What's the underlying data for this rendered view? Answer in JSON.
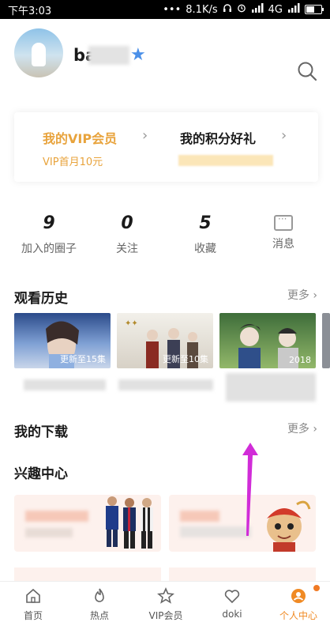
{
  "status_bar": {
    "time": "下午3:03",
    "dots": "•••",
    "network_speed": "8.1K/s",
    "signal_label": "4G"
  },
  "profile": {
    "username_visible": "ba"
  },
  "vip_card": {
    "vip_title": "我的VIP会员",
    "vip_subtitle": "VIP首月10元",
    "points_title": "我的积分好礼"
  },
  "stats": [
    {
      "value": "9",
      "label": "加入的圈子"
    },
    {
      "value": "0",
      "label": "关注"
    },
    {
      "value": "5",
      "label": "收藏"
    },
    {
      "value": "",
      "label": "消息"
    }
  ],
  "history": {
    "title": "观看历史",
    "more": "更多",
    "items": [
      {
        "episode": "更新至15集"
      },
      {
        "episode": "更新至10集"
      },
      {
        "episode": "2018"
      }
    ]
  },
  "downloads": {
    "title": "我的下载",
    "more": "更多"
  },
  "interest": {
    "title": "兴趣中心"
  },
  "tabbar": {
    "tabs": [
      {
        "label": "首页"
      },
      {
        "label": "热点"
      },
      {
        "label": "VIP会员"
      },
      {
        "label": "doki"
      },
      {
        "label": "个人中心"
      }
    ]
  },
  "colors": {
    "accent": "#f08a24",
    "vip_gold": "#e8a33c",
    "annotation_arrow": "#d12cd8"
  }
}
